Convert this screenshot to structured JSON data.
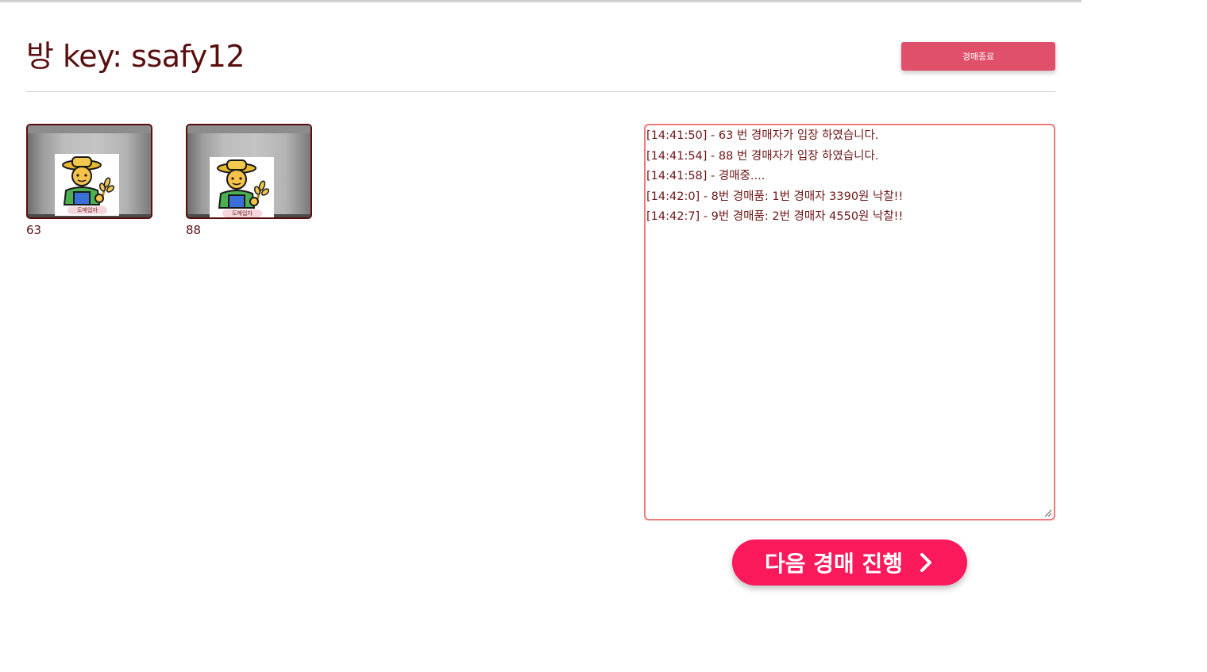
{
  "header": {
    "title": "방 key: ssafy12",
    "end_button_label": "경매종료"
  },
  "participants": [
    {
      "label": "63",
      "avatar_tag": "도매업자",
      "avatar_icon": "farmer-icon"
    },
    {
      "label": "88",
      "avatar_tag": "도매업자",
      "avatar_icon": "farmer-icon"
    }
  ],
  "log": {
    "lines": [
      "[14:41:50] - 63 번 경매자가 입장 하였습니다.",
      "[14:41:54] - 88 번 경매자가 입장 하였습니다.",
      "[14:41:58] - 경매중....",
      "[14:42:0] - 8번 경매품: 1번 경매자 3390원 낙찰!!",
      "[14:42:7] - 9번 경매품: 2번 경매자 4550원 낙찰!!"
    ]
  },
  "actions": {
    "next_label": "다음 경매 진행",
    "next_icon": "chevron-right-icon"
  },
  "colors": {
    "title": "#5a0f0f",
    "end_button": "#e0506a",
    "log_border": "#ef7a7a",
    "log_text": "#6e1616",
    "next_button": "#fa1a5c"
  }
}
